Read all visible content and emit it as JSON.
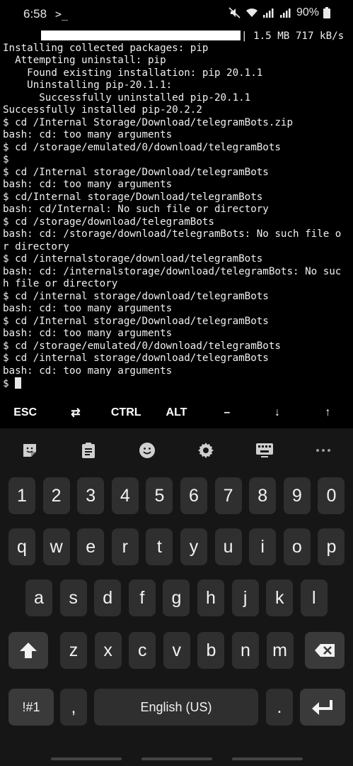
{
  "status_bar": {
    "time": "6:58",
    "prompt_glyph": ">_",
    "battery": "90%"
  },
  "progress": {
    "fraction": 1.0,
    "text": "| 1.5 MB 717 kB/s"
  },
  "terminal_lines": [
    "",
    "Installing collected packages: pip",
    "  Attempting uninstall: pip",
    "    Found existing installation: pip 20.1.1",
    "    Uninstalling pip-20.1.1:",
    "      Successfully uninstalled pip-20.1.1",
    "Successfully installed pip-20.2.2",
    "$ cd /Internal Storage/Download/telegramBots.zip",
    "bash: cd: too many arguments",
    "$ cd /storage/emulated/0/download/telegramBots",
    "$",
    "$ cd /Internal storage/Download/telegramBots",
    "bash: cd: too many arguments",
    "$ cd/Internal storage/Download/telegramBots",
    "bash: cd/Internal: No such file or directory",
    "$ cd /storage/download/telegramBots",
    "bash: cd: /storage/download/telegramBots: No such file o",
    "r directory",
    "$ cd /internalstorage/download/telegramBots",
    "bash: cd: /internalstorage/download/telegramBots: No suc",
    "h file or directory",
    "$ cd /internal storage/download/telegramBots",
    "bash: cd: too many arguments",
    "$ cd /Internal storage/Download/telegramBots",
    "bash: cd: too many arguments",
    "$ cd /storage/emulated/0/download/telegramBots",
    "$ cd /internal storage/download/telegramBots",
    "bash: cd: too many arguments"
  ],
  "current_prompt": "$ ",
  "extra_keys": [
    {
      "name": "esc-key",
      "label": "ESC"
    },
    {
      "name": "tab-key",
      "label": "⇄"
    },
    {
      "name": "ctrl-key",
      "label": "CTRL"
    },
    {
      "name": "alt-key",
      "label": "ALT"
    },
    {
      "name": "dash-key",
      "label": "–"
    },
    {
      "name": "down-arrow-key",
      "label": "↓"
    },
    {
      "name": "up-arrow-key",
      "label": "↑"
    }
  ],
  "keyboard": {
    "toolbar_icons": [
      "sticker-icon",
      "clipboard-icon",
      "emoji-icon",
      "gear-icon",
      "keyboard-icon",
      "more-icon"
    ],
    "row_numbers": [
      "1",
      "2",
      "3",
      "4",
      "5",
      "6",
      "7",
      "8",
      "9",
      "0"
    ],
    "row_q": [
      "q",
      "w",
      "e",
      "r",
      "t",
      "y",
      "u",
      "i",
      "o",
      "p"
    ],
    "row_a": [
      "a",
      "s",
      "d",
      "f",
      "g",
      "h",
      "j",
      "k",
      "l"
    ],
    "row_z": [
      "z",
      "x",
      "c",
      "v",
      "b",
      "n",
      "m"
    ],
    "symbols_label": "!#1",
    "comma_label": ",",
    "space_label": "English (US)",
    "period_label": "."
  }
}
